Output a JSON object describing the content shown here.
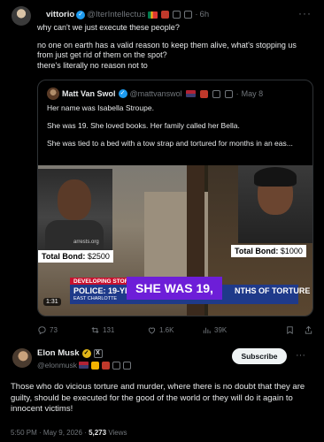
{
  "colors": {
    "accent": "#1d9bf0",
    "verified_gold": "#e2b719",
    "subscribe_bg": "#eff3f4",
    "ticker_red": "#c8102e",
    "ticker_blue": "#1f3a8a",
    "caption_purple": "#6d1ed8"
  },
  "top_post": {
    "name": "vittorio",
    "handle": "@IterIntellectus",
    "time": "6h",
    "text": [
      "why can't we just execute these people?",
      "no one on earth has a valid reason to keep them alive, what's stopping us from just get rid of them on the spot?",
      "there's literally no reason not to"
    ],
    "quoted": {
      "name": "Matt Van Swol",
      "handle": "@mattvanswol",
      "date": "May 8",
      "text": [
        "Her name was Isabella Stroupe.",
        "She was 19. She loved books. Her family called her Bella.",
        "She was tied to a bed with a tow strap and tortured for months in an eas..."
      ],
      "media": {
        "watermark": "arrests.org",
        "bond_left_label": "Total Bond:",
        "bond_left_value": "$2500",
        "bond_right_label": "Total Bond:",
        "bond_right_value": "$1000",
        "ticker_tag": "DEVELOPING STORY",
        "ticker_headline": "POLICE: 19-YE",
        "ticker_headline_end": "NTHS OF TORTURE",
        "ticker_sub": "EAST CHARLOTTE",
        "caption": "SHE WAS 19,",
        "duration": "1:31"
      }
    },
    "actions": {
      "replies": "73",
      "retweets": "131",
      "likes": "1.6K",
      "views": "39K"
    }
  },
  "reply_post": {
    "name": "Elon Musk",
    "handle": "@elonmusk",
    "subscribe_label": "Subscribe",
    "text": "Those who do vicious torture and murder, where there is no doubt that they are guilty, should be executed for the good of the world or they will do it again to innocent victims!",
    "time": "5:50 PM · May 9, 2026 ·",
    "views_count": "5,273",
    "views_label": "Views"
  },
  "icons": [
    "more-icon",
    "reply-icon",
    "retweet-icon",
    "like-icon",
    "views-icon",
    "bookmark-icon",
    "share-icon",
    "verified-icon",
    "x-badge-icon",
    "flag-icon"
  ]
}
